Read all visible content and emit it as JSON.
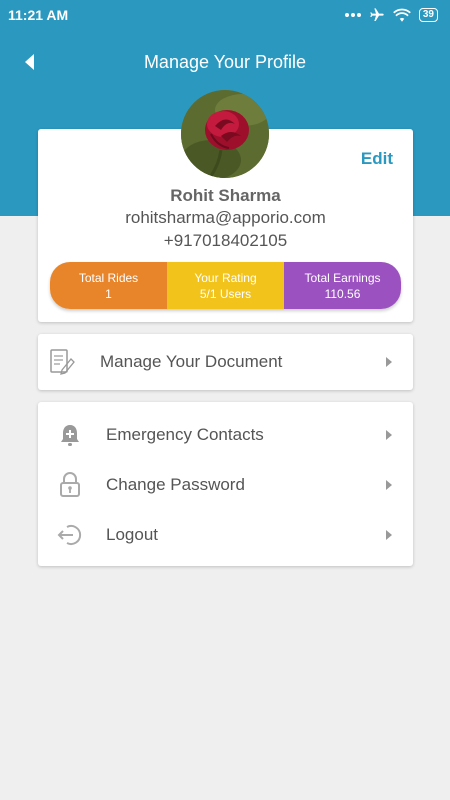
{
  "status_bar": {
    "time": "11:21 AM",
    "battery": "39"
  },
  "header": {
    "title": "Manage Your Profile"
  },
  "profile": {
    "edit_label": "Edit",
    "name": "Rohit Sharma",
    "email": "rohitsharma@apporio.com",
    "phone": "+917018402105"
  },
  "stats": [
    {
      "label": "Total Rides",
      "value": "1"
    },
    {
      "label": "Your Rating",
      "value": "5/1 Users"
    },
    {
      "label": "Total Earnings",
      "value": "110.56"
    }
  ],
  "document": {
    "label": "Manage Your Document"
  },
  "menu": [
    {
      "label": "Emergency Contacts"
    },
    {
      "label": "Change Password"
    },
    {
      "label": "Logout"
    }
  ],
  "colors": {
    "header": "#2b98c0",
    "rides": "#e8852a",
    "rating": "#f2c31a",
    "earnings": "#9b52c0"
  }
}
